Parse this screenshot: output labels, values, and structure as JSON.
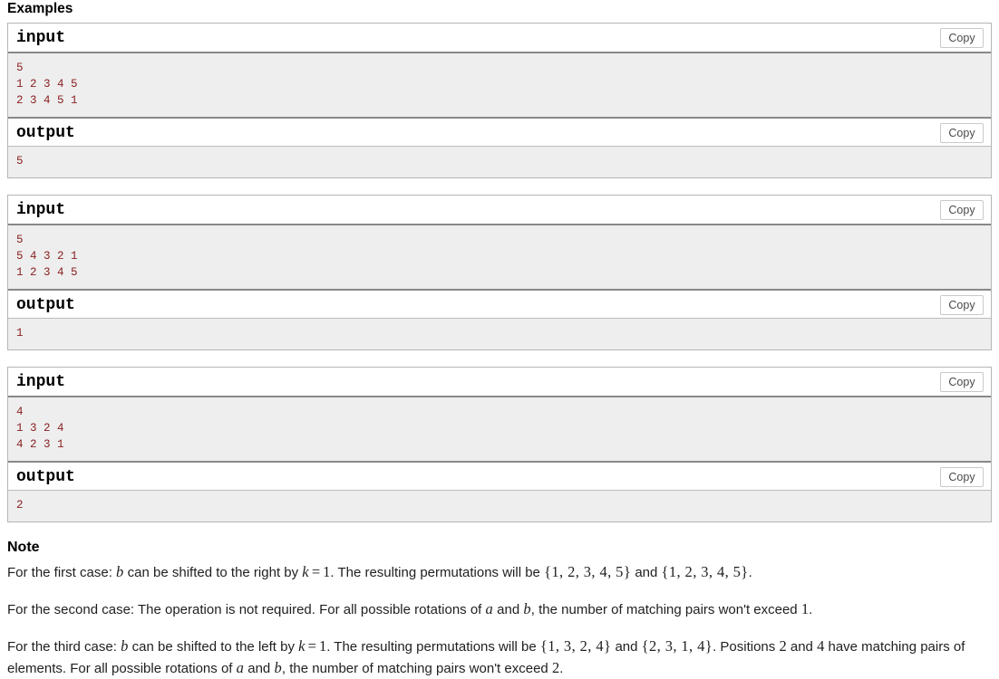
{
  "sections": {
    "examples_heading": "Examples",
    "note_heading": "Note"
  },
  "labels": {
    "input": "input",
    "output": "output",
    "copy": "Copy"
  },
  "examples": [
    {
      "input": "5\n1 2 3 4 5\n2 3 4 5 1",
      "output": "5"
    },
    {
      "input": "5\n5 4 3 2 1\n1 2 3 4 5",
      "output": "1"
    },
    {
      "input": "4\n1 3 2 4\n4 2 3 1",
      "output": "2"
    }
  ],
  "note": {
    "p1": {
      "t1": "For the first case: ",
      "m1": "b",
      "t2": " can be shifted to the right by ",
      "m2": "k",
      "eq": "=",
      "m3": "1",
      "t3": ". The resulting permutations will be ",
      "set1": "{1, 2, 3, 4, 5}",
      "t4": " and ",
      "set2": "{1, 2, 3, 4, 5}",
      "t5": "."
    },
    "p2": {
      "t1": "For the second case: The operation is not required. For all possible rotations of ",
      "m1": "a",
      "t2": " and ",
      "m2": "b",
      "t3": ", the number of matching pairs won't exceed ",
      "m3": "1",
      "t4": "."
    },
    "p3": {
      "t1": "For the third case: ",
      "m1": "b",
      "t2": " can be shifted to the left by ",
      "m2": "k",
      "eq": "=",
      "m3": "1",
      "t3": ". The resulting permutations will be ",
      "set1": "{1, 3, 2, 4}",
      "t4": " and ",
      "set2": "{2, 3, 1, 4}",
      "t5": ". Positions ",
      "m4": "2",
      "t6": " and ",
      "m5": "4",
      "t7": " have matching pairs of elements. For all possible rotations of ",
      "m6": "a",
      "t8": " and ",
      "m7": "b",
      "t9": ", the number of matching pairs won't exceed ",
      "m8": "2",
      "t10": "."
    }
  },
  "colors": {
    "data_text": "#8a2121",
    "data_bg": "#eeeeee",
    "border": "#b5b5b5",
    "separator": "#888888"
  }
}
